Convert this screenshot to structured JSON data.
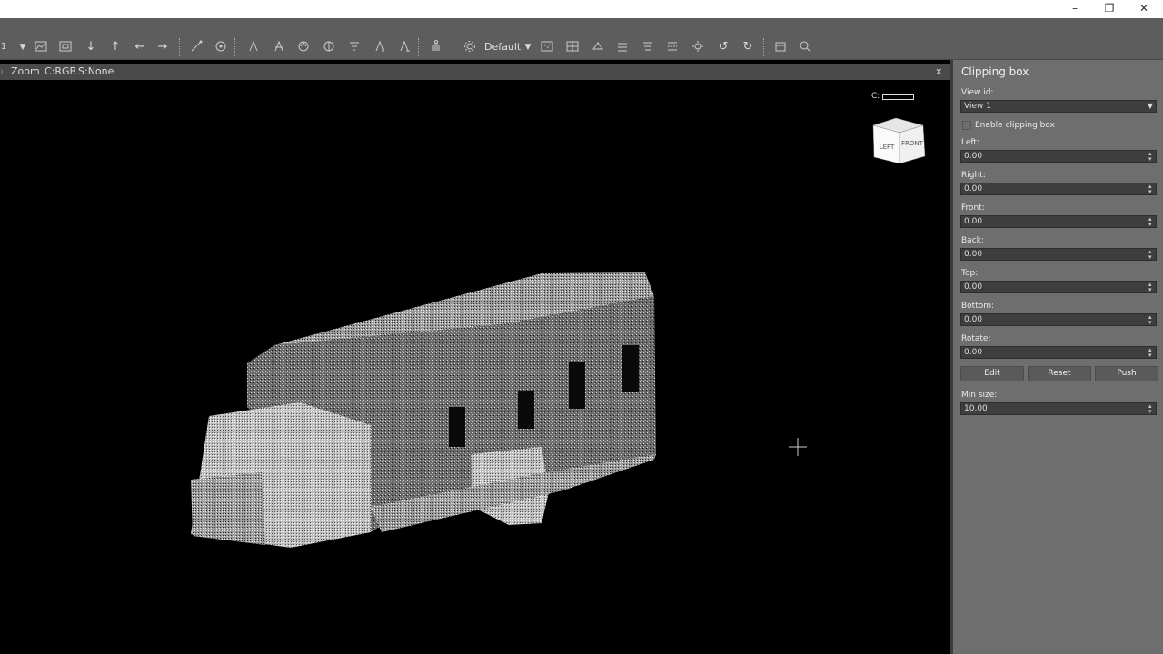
{
  "window": {
    "minimize": "–",
    "restore": "❐",
    "close": "✕"
  },
  "toolbar": {
    "counter": "1",
    "preset": "Default"
  },
  "viewport_header": {
    "mode": "Zoom",
    "color": "C:RGB",
    "selection": "S:None",
    "close": "x",
    "color_indicator": "C:"
  },
  "navcube": {
    "left": "LEFT",
    "front": "FRONT"
  },
  "panel": {
    "title": "Clipping box",
    "view_id_label": "View id:",
    "view_id_value": "View 1",
    "enable_label": "Enable clipping box",
    "fields": [
      {
        "label": "Left:",
        "value": "0.00"
      },
      {
        "label": "Right:",
        "value": "0.00"
      },
      {
        "label": "Front:",
        "value": "0.00"
      },
      {
        "label": "Back:",
        "value": "0.00"
      },
      {
        "label": "Top:",
        "value": "0.00"
      },
      {
        "label": "Bottom:",
        "value": "0.00"
      },
      {
        "label": "Rotate:",
        "value": "0.00"
      }
    ],
    "edit": "Edit",
    "reset": "Reset",
    "push": "Push",
    "min_size_label": "Min size:",
    "min_size_value": "10.00"
  }
}
